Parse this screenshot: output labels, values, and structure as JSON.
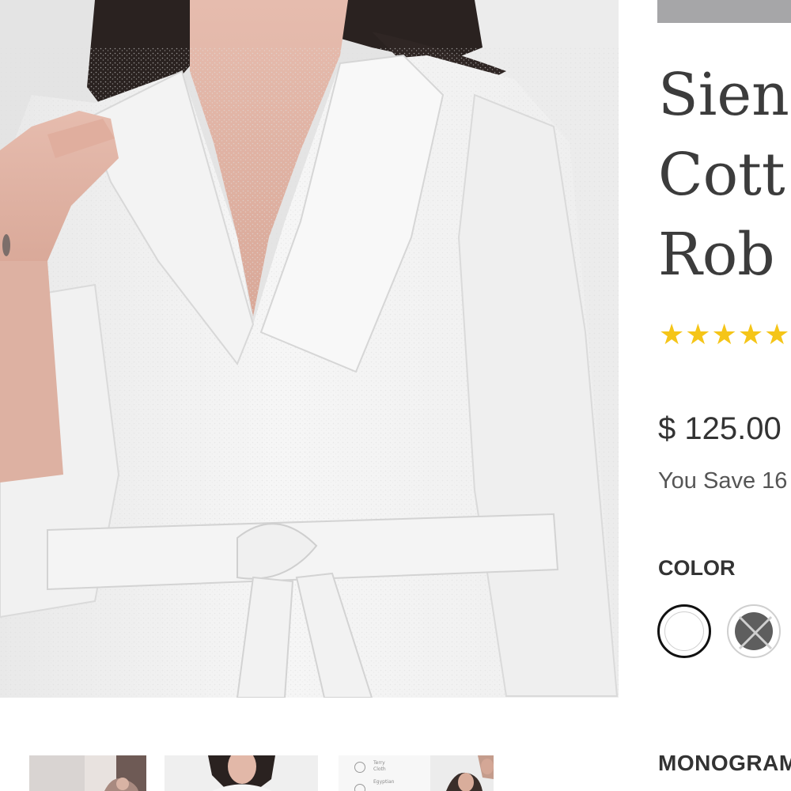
{
  "product": {
    "title_lines": [
      "Sien",
      "Cott",
      "Rob"
    ],
    "rating_stars": "★★★★★",
    "rating_value": 5,
    "price": "$ 125.00",
    "savings_text": "You Save 16"
  },
  "header": {
    "bar_color": "#a6a6a8"
  },
  "options": {
    "color_label": "COLOR",
    "swatches": [
      {
        "name": "white",
        "color": "#ffffff",
        "selected": true,
        "available": true
      },
      {
        "name": "grey",
        "color": "#5e5e5e",
        "selected": false,
        "available": false
      }
    ],
    "monogram_label": "MONOGRAM"
  },
  "gallery": {
    "thumb_caption_lines": [
      "Terry",
      "Cloth",
      "",
      "Egyptian"
    ]
  },
  "colors": {
    "star": "#f5c518",
    "title_text": "#3c3c3c",
    "selected_border": "#111111"
  }
}
